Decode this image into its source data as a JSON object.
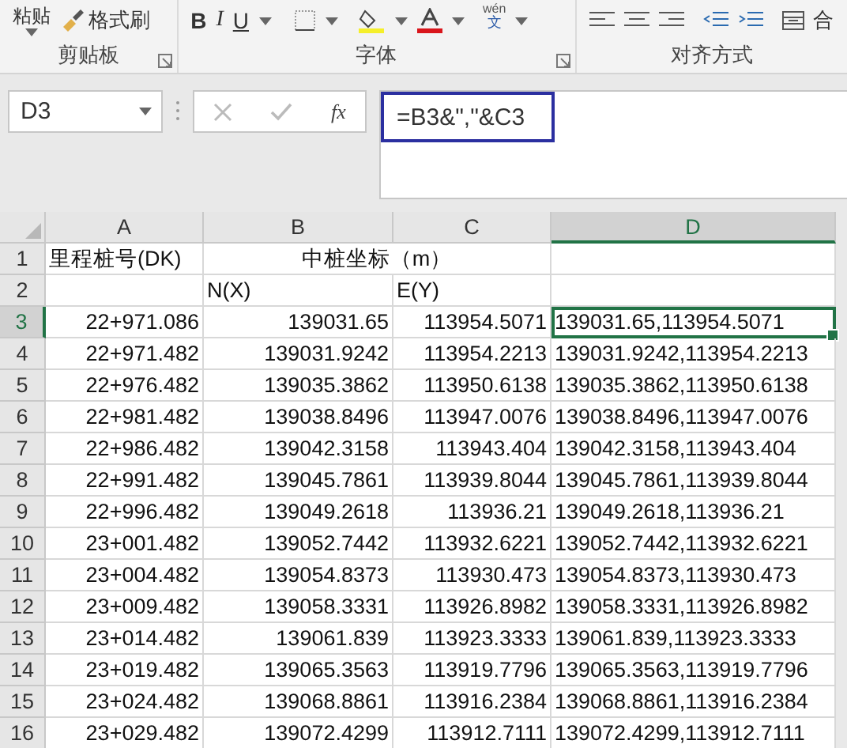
{
  "ribbon": {
    "paste_label": "粘贴",
    "format_painter": "格式刷",
    "bold": "B",
    "italic": "I",
    "underline": "U",
    "phonetic_top": "wén",
    "phonetic_bottom": "文",
    "merge_label": "合",
    "groups": [
      "剪贴板",
      "字体",
      "对齐方式"
    ]
  },
  "formula_bar": {
    "name_box": "D3",
    "fx": "fx",
    "formula": "=B3&\",\"&C3",
    "highlighted": true
  },
  "sheet": {
    "columns": [
      {
        "label": "A",
        "selected": false
      },
      {
        "label": "B",
        "selected": false
      },
      {
        "label": "C",
        "selected": false
      },
      {
        "label": "D",
        "selected": true
      }
    ],
    "rows": [
      {
        "header": "1",
        "selected": false,
        "kind": "title",
        "a": "里程桩号(DK)",
        "bc": "中桩坐标（m）"
      },
      {
        "header": "2",
        "selected": false,
        "kind": "subhead",
        "b": "N(X)",
        "c": "E(Y)"
      },
      {
        "header": "3",
        "selected": true,
        "kind": "data",
        "a": "22+971.086",
        "b": "139031.65",
        "c": "113954.5071",
        "d": "139031.65,113954.5071"
      },
      {
        "header": "4",
        "selected": false,
        "kind": "data",
        "a": "22+971.482",
        "b": "139031.9242",
        "c": "113954.2213",
        "d": "139031.9242,113954.2213"
      },
      {
        "header": "5",
        "selected": false,
        "kind": "data",
        "a": "22+976.482",
        "b": "139035.3862",
        "c": "113950.6138",
        "d": "139035.3862,113950.6138"
      },
      {
        "header": "6",
        "selected": false,
        "kind": "data",
        "a": "22+981.482",
        "b": "139038.8496",
        "c": "113947.0076",
        "d": "139038.8496,113947.0076"
      },
      {
        "header": "7",
        "selected": false,
        "kind": "data",
        "a": "22+986.482",
        "b": "139042.3158",
        "c": "113943.404",
        "d": "139042.3158,113943.404"
      },
      {
        "header": "8",
        "selected": false,
        "kind": "data",
        "a": "22+991.482",
        "b": "139045.7861",
        "c": "113939.8044",
        "d": "139045.7861,113939.8044"
      },
      {
        "header": "9",
        "selected": false,
        "kind": "data",
        "a": "22+996.482",
        "b": "139049.2618",
        "c": "113936.21",
        "d": "139049.2618,113936.21"
      },
      {
        "header": "10",
        "selected": false,
        "kind": "data",
        "a": "23+001.482",
        "b": "139052.7442",
        "c": "113932.6221",
        "d": "139052.7442,113932.6221"
      },
      {
        "header": "11",
        "selected": false,
        "kind": "data",
        "a": "23+004.482",
        "b": "139054.8373",
        "c": "113930.473",
        "d": "139054.8373,113930.473"
      },
      {
        "header": "12",
        "selected": false,
        "kind": "data",
        "a": "23+009.482",
        "b": "139058.3331",
        "c": "113926.8982",
        "d": "139058.3331,113926.8982"
      },
      {
        "header": "13",
        "selected": false,
        "kind": "data",
        "a": "23+014.482",
        "b": "139061.839",
        "c": "113923.3333",
        "d": "139061.839,113923.3333"
      },
      {
        "header": "14",
        "selected": false,
        "kind": "data",
        "a": "23+019.482",
        "b": "139065.3563",
        "c": "113919.7796",
        "d": "139065.3563,113919.7796"
      },
      {
        "header": "15",
        "selected": false,
        "kind": "data",
        "a": "23+024.482",
        "b": "139068.8861",
        "c": "113916.2384",
        "d": "139068.8861,113916.2384"
      },
      {
        "header": "16",
        "selected": false,
        "kind": "data",
        "a": "23+029.482",
        "b": "139072.4299",
        "c": "113912.7111",
        "d": "139072.4299,113912.7111"
      }
    ]
  }
}
